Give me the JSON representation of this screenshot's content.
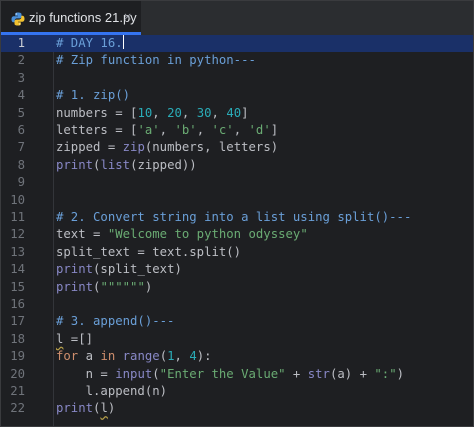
{
  "tab": {
    "title": "zip functions 21.py",
    "icon": "python-file-icon",
    "close_glyph": "×"
  },
  "colors": {
    "background": "#1e1f22",
    "current_line": "#1a3068",
    "tab_underline": "#3574f0",
    "comment": "#6a9fd8",
    "string": "#6aab73",
    "number": "#2aacb8",
    "keyword": "#cf8e6d",
    "builtin": "#8888c6"
  },
  "editor": {
    "current_line": 1,
    "lines": [
      {
        "n": "1",
        "tokens": [
          {
            "t": "cmt",
            "v": "# DAY 16."
          }
        ]
      },
      {
        "n": "2",
        "tokens": [
          {
            "t": "cmt",
            "v": "# Zip function in python---"
          }
        ]
      },
      {
        "n": "3",
        "tokens": []
      },
      {
        "n": "4",
        "tokens": [
          {
            "t": "cmt",
            "v": "# 1. zip()"
          }
        ]
      },
      {
        "n": "5",
        "tokens": [
          {
            "t": "",
            "v": "numbers = ["
          },
          {
            "t": "num",
            "v": "10"
          },
          {
            "t": "",
            "v": ", "
          },
          {
            "t": "num",
            "v": "20"
          },
          {
            "t": "",
            "v": ", "
          },
          {
            "t": "num",
            "v": "30"
          },
          {
            "t": "",
            "v": ", "
          },
          {
            "t": "num",
            "v": "40"
          },
          {
            "t": "",
            "v": "]"
          }
        ]
      },
      {
        "n": "6",
        "tokens": [
          {
            "t": "",
            "v": "letters = ["
          },
          {
            "t": "str",
            "v": "'a'"
          },
          {
            "t": "",
            "v": ", "
          },
          {
            "t": "str",
            "v": "'b'"
          },
          {
            "t": "",
            "v": ", "
          },
          {
            "t": "str",
            "v": "'c'"
          },
          {
            "t": "",
            "v": ", "
          },
          {
            "t": "str",
            "v": "'d'"
          },
          {
            "t": "",
            "v": "]"
          }
        ]
      },
      {
        "n": "7",
        "tokens": [
          {
            "t": "",
            "v": "zipped = "
          },
          {
            "t": "bi",
            "v": "zip"
          },
          {
            "t": "",
            "v": "(numbers, letters)"
          }
        ]
      },
      {
        "n": "8",
        "tokens": [
          {
            "t": "bi",
            "v": "print"
          },
          {
            "t": "",
            "v": "("
          },
          {
            "t": "bi",
            "v": "list"
          },
          {
            "t": "",
            "v": "(zipped))"
          }
        ]
      },
      {
        "n": "9",
        "tokens": []
      },
      {
        "n": "10",
        "tokens": []
      },
      {
        "n": "11",
        "tokens": [
          {
            "t": "cmt",
            "v": "# 2. Convert string into a list using split()---"
          }
        ]
      },
      {
        "n": "12",
        "tokens": [
          {
            "t": "",
            "v": "text = "
          },
          {
            "t": "str",
            "v": "\"Welcome to python odyssey\""
          }
        ]
      },
      {
        "n": "13",
        "tokens": [
          {
            "t": "",
            "v": "split_text = text.split()"
          }
        ]
      },
      {
        "n": "14",
        "tokens": [
          {
            "t": "bi",
            "v": "print"
          },
          {
            "t": "",
            "v": "(split_text)"
          }
        ]
      },
      {
        "n": "15",
        "tokens": [
          {
            "t": "bi",
            "v": "print"
          },
          {
            "t": "",
            "v": "("
          },
          {
            "t": "str",
            "v": "\"\"\"\"\"\""
          },
          {
            "t": "",
            "v": ")"
          }
        ]
      },
      {
        "n": "16",
        "tokens": []
      },
      {
        "n": "17",
        "tokens": [
          {
            "t": "cmt",
            "v": "# 3. append()---"
          }
        ]
      },
      {
        "n": "18",
        "tokens": [
          {
            "t": "sq",
            "v": "l"
          },
          {
            "t": "",
            "v": " =[]"
          }
        ]
      },
      {
        "n": "19",
        "tokens": [
          {
            "t": "kw",
            "v": "for"
          },
          {
            "t": "",
            "v": " a "
          },
          {
            "t": "kw",
            "v": "in"
          },
          {
            "t": "",
            "v": " "
          },
          {
            "t": "bi",
            "v": "range"
          },
          {
            "t": "",
            "v": "("
          },
          {
            "t": "num",
            "v": "1"
          },
          {
            "t": "",
            "v": ", "
          },
          {
            "t": "num",
            "v": "4"
          },
          {
            "t": "",
            "v": "):"
          }
        ]
      },
      {
        "n": "20",
        "tokens": [
          {
            "t": "",
            "v": "    n = "
          },
          {
            "t": "bi",
            "v": "input"
          },
          {
            "t": "",
            "v": "("
          },
          {
            "t": "str",
            "v": "\"Enter the Value\""
          },
          {
            "t": "",
            "v": " + "
          },
          {
            "t": "bi",
            "v": "str"
          },
          {
            "t": "",
            "v": "(a) + "
          },
          {
            "t": "str",
            "v": "\":\""
          },
          {
            "t": "",
            "v": ")"
          }
        ]
      },
      {
        "n": "21",
        "tokens": [
          {
            "t": "",
            "v": "    l.append(n)"
          }
        ]
      },
      {
        "n": "22",
        "tokens": [
          {
            "t": "bi",
            "v": "print"
          },
          {
            "t": "",
            "v": "("
          },
          {
            "t": "sq",
            "v": "l"
          },
          {
            "t": "",
            "v": ")"
          }
        ]
      }
    ]
  }
}
